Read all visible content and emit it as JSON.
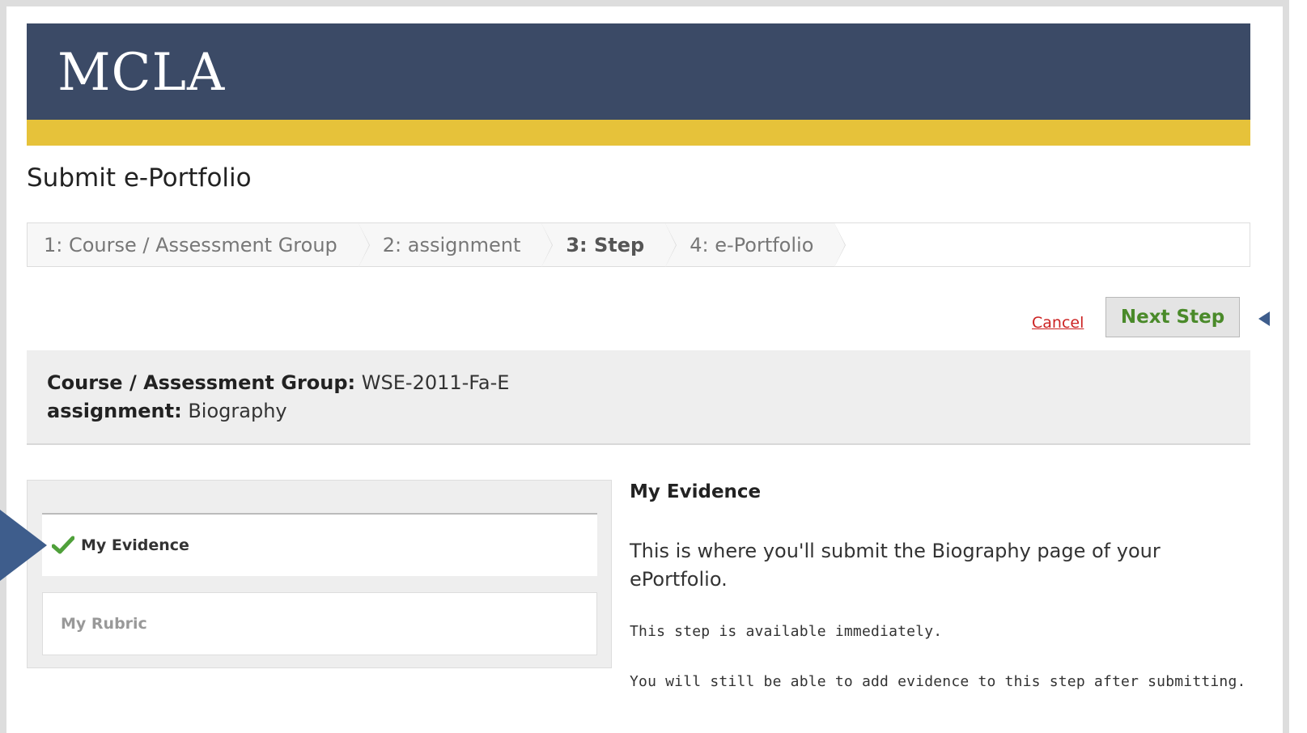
{
  "header": {
    "logo_text": "MCLA",
    "brand_color": "#3b4a66",
    "stripe_color": "#e6c23a"
  },
  "page_title": "Submit e-Portfolio",
  "wizard": {
    "steps": [
      {
        "label": "1: Course / Assessment Group",
        "current": false
      },
      {
        "label": "2: assignment",
        "current": false
      },
      {
        "label": "3: Step",
        "current": true
      },
      {
        "label": "4: e-Portfolio",
        "current": false
      }
    ]
  },
  "actions": {
    "cancel_label": "Cancel",
    "next_label": "Next Step"
  },
  "info": {
    "course_label": "Course / Assessment Group:",
    "course_value": "WSE-2011-Fa-E",
    "assignment_label": "assignment:",
    "assignment_value": "Biography"
  },
  "steps_panel": {
    "items": [
      {
        "label": "My Evidence",
        "icon": "check-icon",
        "active": true
      },
      {
        "label": "My Rubric",
        "active": false
      }
    ]
  },
  "detail": {
    "title": "My Evidence",
    "description": "This is where you'll submit the Biography page of your ePortfolio.",
    "availability": "This step is available immediately.",
    "note": "You will still be able to add evidence to this step after submitting."
  }
}
